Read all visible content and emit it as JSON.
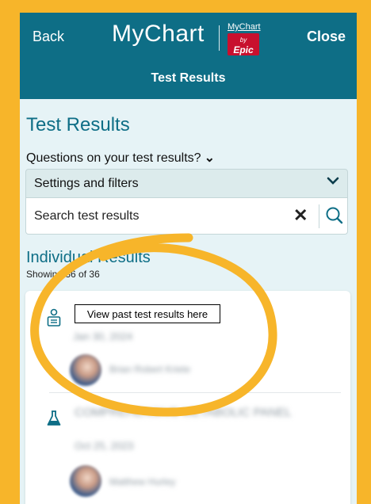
{
  "topbar": {
    "back_label": "Back",
    "brand": "MyChart",
    "epic_badge_top": "MyChart",
    "epic_badge_by": "by",
    "epic_badge_epic": "Epic",
    "close_label": "Close",
    "subtitle": "Test Results"
  },
  "page": {
    "title": "Test Results",
    "questions_label": "Questions on your test results?",
    "settings_label": "Settings and filters",
    "search_placeholder": "Search test results",
    "section_title": "Individual Results",
    "showing_text": "Showing 36 of 36"
  },
  "results": [
    {
      "title": "",
      "date": "Jan 30, 2024",
      "provider": "Brian Robert Kriete",
      "icon": "clipboard-person-icon"
    },
    {
      "title": "COMPREHENSIVE METABOLIC PANEL",
      "date": "Oct 25, 2023",
      "provider": "Matthew Hurley",
      "icon": "flask-icon"
    }
  ],
  "annotation": {
    "tooltip_text": "View past test results here",
    "circle_color": "#f7b52a"
  },
  "colors": {
    "frame": "#f7b52a",
    "header": "#0e6e86",
    "background": "#e6f3f6",
    "accent": "#0e6e86"
  }
}
